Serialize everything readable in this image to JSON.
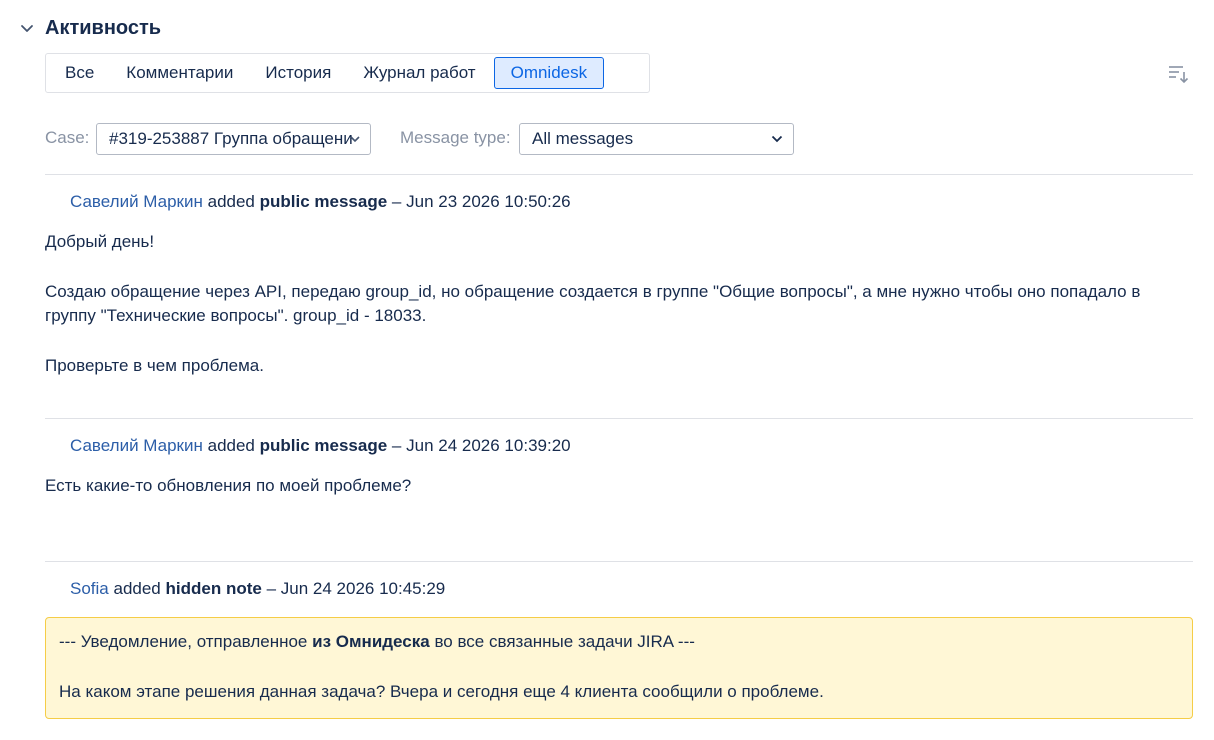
{
  "section": {
    "title": "Активность"
  },
  "tabs": [
    {
      "label": "Все",
      "active": false
    },
    {
      "label": "Комментарии",
      "active": false
    },
    {
      "label": "История",
      "active": false
    },
    {
      "label": "Журнал работ",
      "active": false
    },
    {
      "label": "Omnidesk",
      "active": true
    }
  ],
  "filters": {
    "case_label": "Case:",
    "case_value": "#319-253887 Группа обращени",
    "message_type_label": "Message type:",
    "message_type_value": "All messages"
  },
  "entries": [
    {
      "author": "Савелий Маркин",
      "action": "added",
      "type": "public message",
      "sep": "–",
      "time": "Jun 23 2026 10:50:26",
      "lines": [
        "Добрый день!",
        "Создаю обращение через API, передаю group_id, но обращение создается в группе \"Общие вопросы\", а мне нужно чтобы оно попадало в",
        "группу \"Технические вопросы\". group_id - 18033.",
        "Проверьте в чем проблема."
      ]
    },
    {
      "author": "Савелий Маркин",
      "action": "added",
      "type": "public message",
      "sep": "–",
      "time": "Jun 24 2026 10:39:20",
      "lines": [
        "Есть какие-то обновления по моей проблеме?"
      ]
    },
    {
      "author": "Sofia",
      "action": "added",
      "type": "hidden note",
      "sep": "–",
      "time": "Jun 24 2026 10:45:29",
      "note": {
        "prefix": "--- Уведомление, отправленное",
        "bold": "из Омнидеска",
        "suffix": "во все связанные",
        "tail": "задачи JIRA ---",
        "message": "На каком этапе решения данная задача? Вчера и сегодня еще 4 клиента сообщили о проблеме."
      }
    }
  ],
  "colors": {
    "link": "#2c5ea8",
    "active_tab": "#0c66e4",
    "note_bg": "#fff7d6",
    "note_border": "#f5cd47"
  }
}
